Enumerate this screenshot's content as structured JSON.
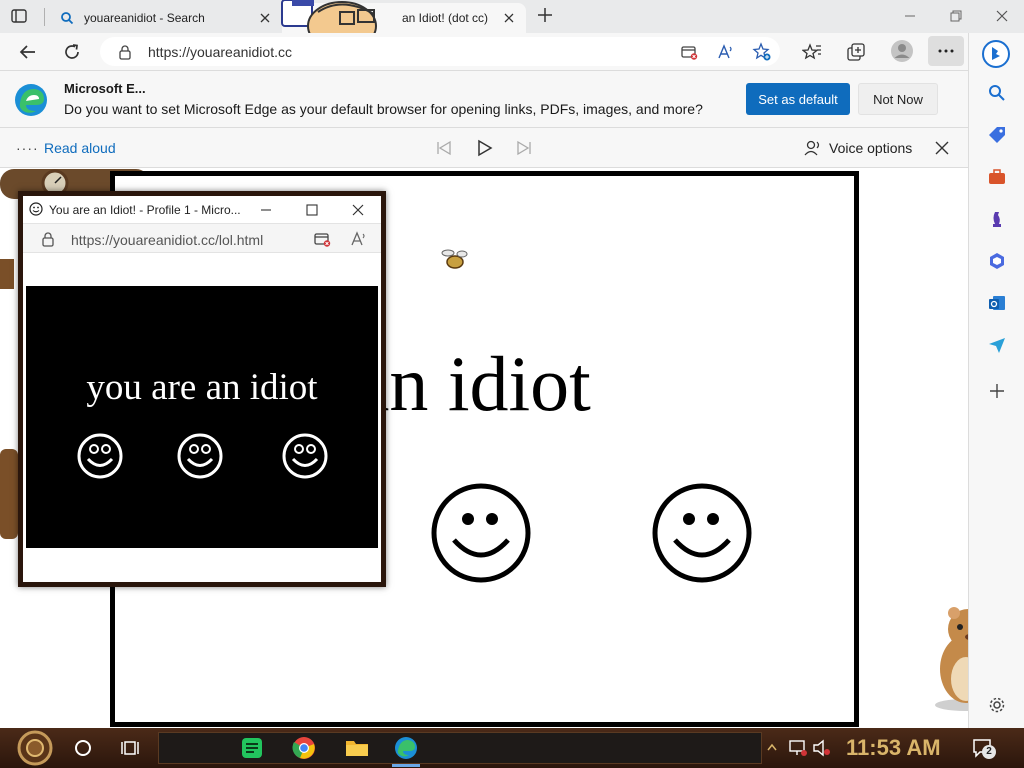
{
  "tabs": [
    {
      "title": "youareanidiot - Search",
      "active": false
    },
    {
      "title": "an Idiot! (dot cc)",
      "active": true
    }
  ],
  "address_bar": {
    "url": "https://youareanidiot.cc"
  },
  "infobar": {
    "title": "Microsoft E...",
    "message": "Do you want to set Microsoft Edge as your default browser for opening links, PDFs, images, and more?",
    "primary_label": "Set as default",
    "secondary_label": "Not Now"
  },
  "read_aloud": {
    "dots": "····",
    "label": "Read aloud",
    "voice_label": "Voice options"
  },
  "page": {
    "main_text": "are an idiot"
  },
  "popup": {
    "title": "You are an Idiot! - Profile 1 - Micro...",
    "url": "https://youareanidiot.cc/lol.html",
    "text": "you are an idiot"
  },
  "taskbar": {
    "clock": "11:53 AM",
    "notification_count": "2"
  },
  "colors": {
    "edge_blue": "#0f6cbd",
    "chrome_gray": "#f7f7f7",
    "taskbar_brown": "#3a1f10",
    "clock_gold": "#d9b56a"
  }
}
